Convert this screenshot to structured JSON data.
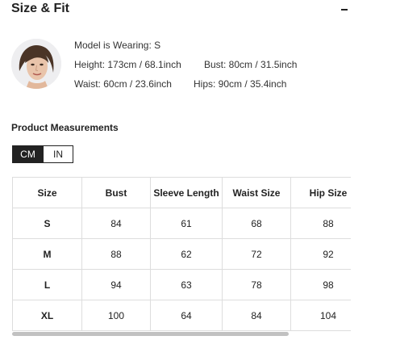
{
  "header": {
    "title": "Size & Fit"
  },
  "model": {
    "wearing": "Model is Wearing: S",
    "height": "Height: 173cm / 68.1inch",
    "bust": "Bust: 80cm / 31.5inch",
    "waist": "Waist: 60cm / 23.6inch",
    "hips": "Hips: 90cm / 35.4inch"
  },
  "measurements": {
    "title": "Product Measurements",
    "units": [
      "CM",
      "IN"
    ],
    "active_unit": "CM",
    "columns": [
      "Size",
      "Bust",
      "Sleeve Length",
      "Waist Size",
      "Hip Size"
    ],
    "rows": [
      [
        "S",
        "84",
        "61",
        "68",
        "88"
      ],
      [
        "M",
        "88",
        "62",
        "72",
        "92"
      ],
      [
        "L",
        "94",
        "63",
        "78",
        "98"
      ],
      [
        "XL",
        "100",
        "64",
        "84",
        "104"
      ]
    ]
  }
}
